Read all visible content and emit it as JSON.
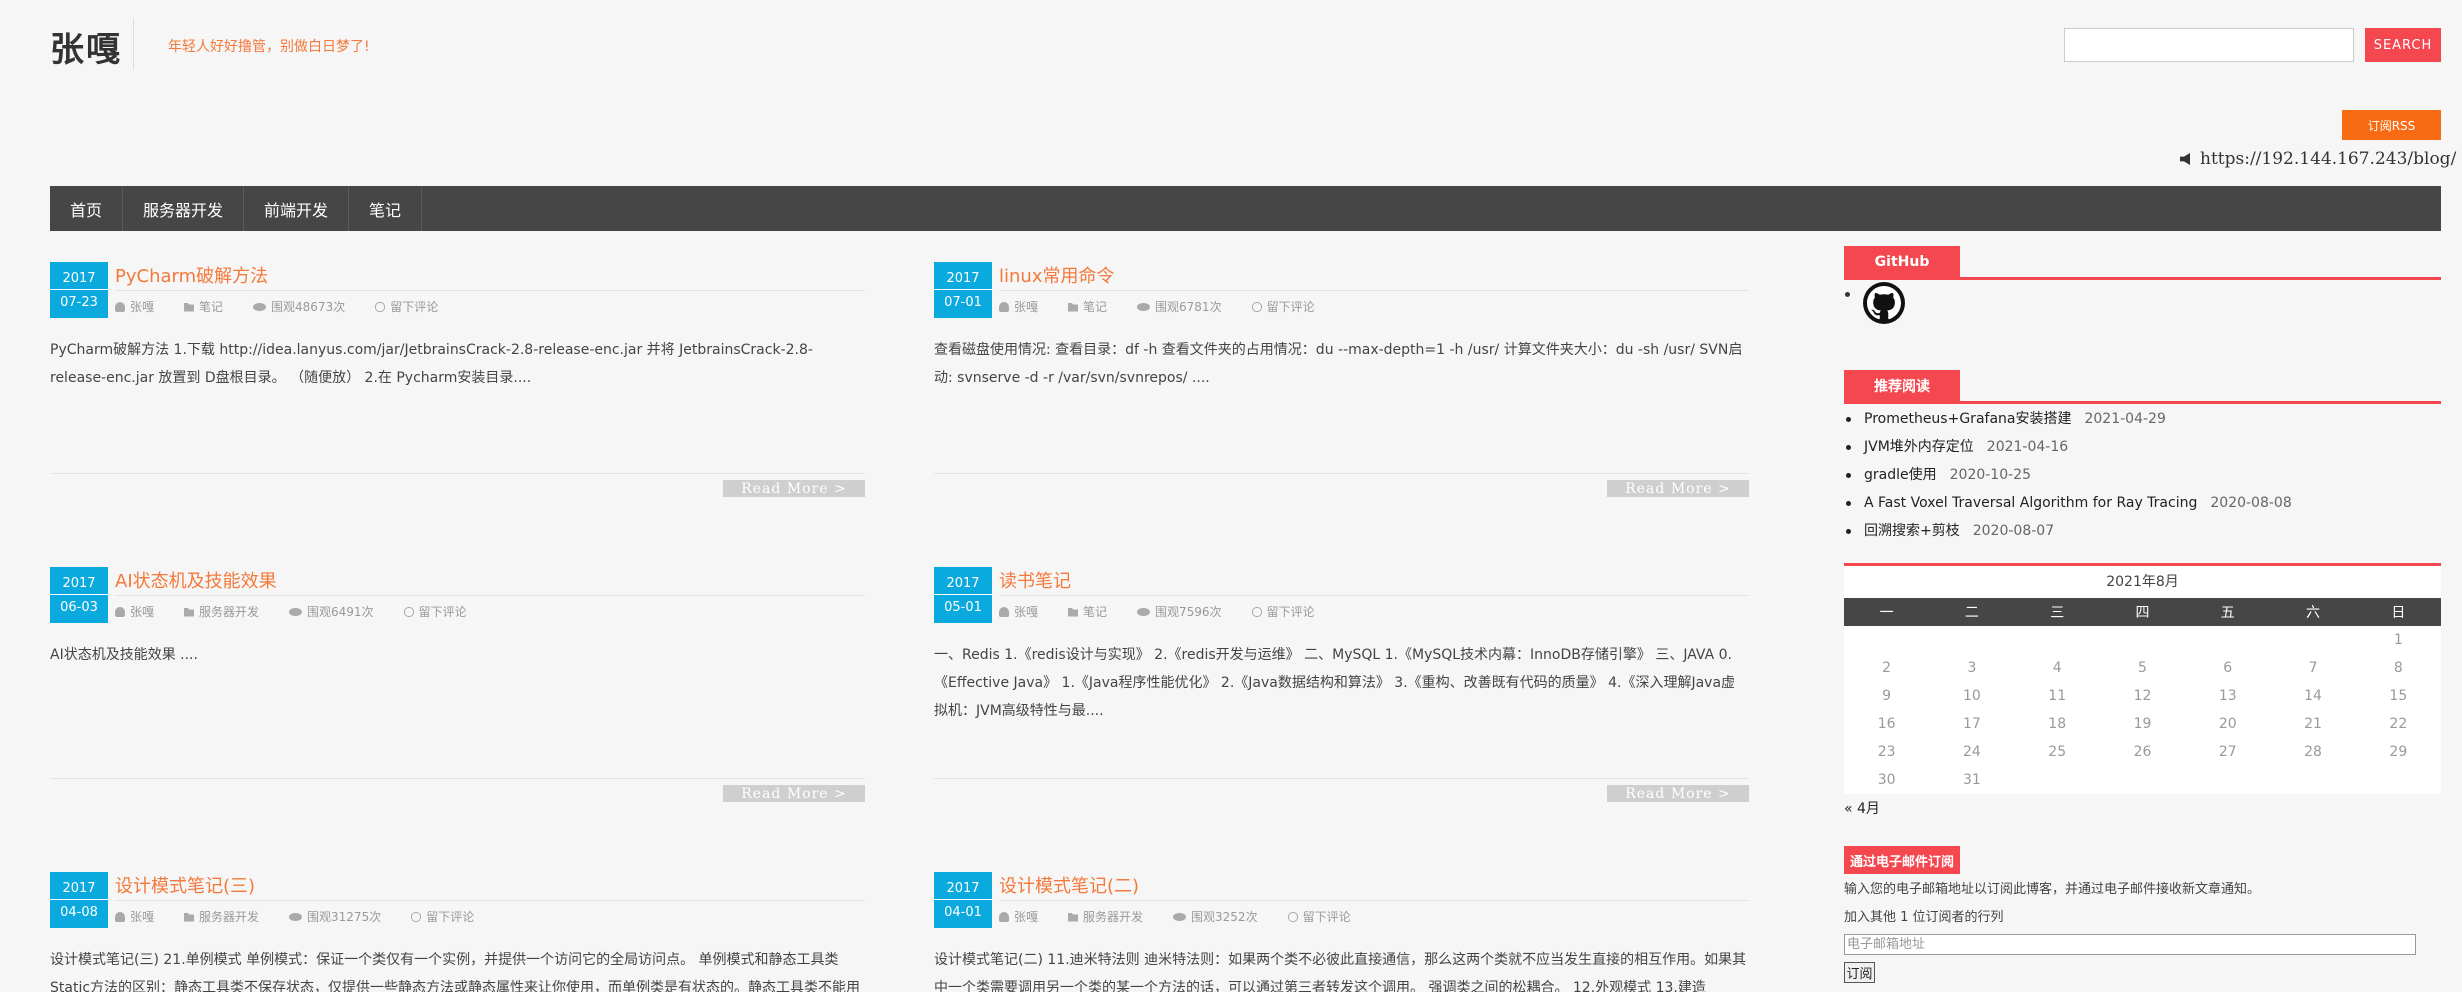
{
  "header": {
    "site_title": "张嘎",
    "tagline": "年轻人好好撸管，别做白日梦了!",
    "search_button": "SEARCH",
    "rss_button": "订阅RSS",
    "url": "https://192.144.167.243/blog/"
  },
  "nav": [
    "首页",
    "服务器开发",
    "前端开发",
    "笔记"
  ],
  "posts": [
    {
      "year": "2017",
      "day": "07-23",
      "title": "PyCharm破解方法",
      "author": "张嘎",
      "category": "笔记",
      "views": "围观48673次",
      "comments": "留下评论",
      "excerpt": "PyCharm破解方法  1.下载 http://idea.lanyus.com/jar/JetbrainsCrack-2.8-release-enc.jar 并将 JetbrainsCrack-2.8-release-enc.jar 放置到 D盘根目录。 （随便放） 2.在 Pycharm安装目录....",
      "read_more": "Read More >"
    },
    {
      "year": "2017",
      "day": "07-01",
      "title": "linux常用命令",
      "author": "张嘎",
      "category": "笔记",
      "views": "围观6781次",
      "comments": "留下评论",
      "excerpt": "查看磁盘使用情况:   查看目录：df -h 查看文件夹的占用情况：du --max-depth=1 -h /usr/ 计算文件夹大小：du -sh /usr/ SVN启动:   svnserve -d -r /var/svn/svnrepos/ ....",
      "read_more": "Read More >"
    },
    {
      "year": "2017",
      "day": "06-03",
      "title": "AI状态机及技能效果",
      "author": "张嘎",
      "category": "服务器开发",
      "views": "围观6491次",
      "comments": "留下评论",
      "excerpt": "AI状态机及技能效果  ....",
      "read_more": "Read More >"
    },
    {
      "year": "2017",
      "day": "05-01",
      "title": "读书笔记",
      "author": "张嘎",
      "category": "笔记",
      "views": "围观7596次",
      "comments": "留下评论",
      "excerpt": "一、Redis 1.《redis设计与实现》 2.《redis开发与运维》 二、MySQL 1.《MySQL技术内幕：InnoDB存储引擎》 三、JAVA 0.《Effective Java》 1.《Java程序性能优化》 2.《Java数据结构和算法》 3.《重构、改善既有代码的质量》 4.《深入理解Java虚拟机：JVM高级特性与最....",
      "read_more": "Read More >"
    },
    {
      "year": "2017",
      "day": "04-08",
      "title": "设计模式笔记(三)",
      "author": "张嘎",
      "category": "服务器开发",
      "views": "围观31275次",
      "comments": "留下评论",
      "excerpt": "设计模式笔记(三)  21.单例模式 单例模式：保证一个类仅有一个实例，并提供一个访问它的全局访问点。 单例模式和静态工具类Static方法的区别：静态工具类不保存状态，仅提供一些静态方法或静态属性来让你使用，而单例类是有状态的。静态工具类不能用"
    },
    {
      "year": "2017",
      "day": "04-01",
      "title": "设计模式笔记(二)",
      "author": "张嘎",
      "category": "服务器开发",
      "views": "围观3252次",
      "comments": "留下评论",
      "excerpt": "设计模式笔记(二)  11.迪米特法则 迪米特法则：如果两个类不必彼此直接通信，那么这两个类就不应当发生直接的相互作用。如果其中一个类需要调用另一个类的某一个方法的话，可以通过第三者转发这个调用。 强调类之间的松耦合。 12.外观模式 13.建造"
    }
  ],
  "sidebar": {
    "github_title": "GitHub",
    "recommend_title": "推荐阅读",
    "recommend": [
      {
        "title": "Prometheus+Grafana安装搭建",
        "date": "2021-04-29"
      },
      {
        "title": "JVM堆外内存定位",
        "date": "2021-04-16"
      },
      {
        "title": "gradle使用",
        "date": "2020-10-25"
      },
      {
        "title": "A Fast Voxel Traversal Algorithm for Ray Tracing",
        "date": "2020-08-08"
      },
      {
        "title": "回溯搜索+剪枝",
        "date": "2020-08-07"
      }
    ],
    "calendar": {
      "caption": "2021年8月",
      "weekdays": [
        "一",
        "二",
        "三",
        "四",
        "五",
        "六",
        "日"
      ],
      "weeks": [
        [
          "",
          "",
          "",
          "",
          "",
          "",
          "1"
        ],
        [
          "2",
          "3",
          "4",
          "5",
          "6",
          "7",
          "8"
        ],
        [
          "9",
          "10",
          "11",
          "12",
          "13",
          "14",
          "15"
        ],
        [
          "16",
          "17",
          "18",
          "19",
          "20",
          "21",
          "22"
        ],
        [
          "23",
          "24",
          "25",
          "26",
          "27",
          "28",
          "29"
        ],
        [
          "30",
          "31",
          "",
          "",
          "",
          "",
          ""
        ]
      ],
      "prev": "« 4月"
    },
    "email_title": "通过电子邮件订阅",
    "email_desc": "输入您的电子邮箱地址以订阅此博客，并通过电子邮件接收新文章通知。",
    "subscriber_count": "加入其他 1 位订阅者的行列",
    "email_placeholder": "电子邮箱地址",
    "subscribe_button": "订阅"
  }
}
